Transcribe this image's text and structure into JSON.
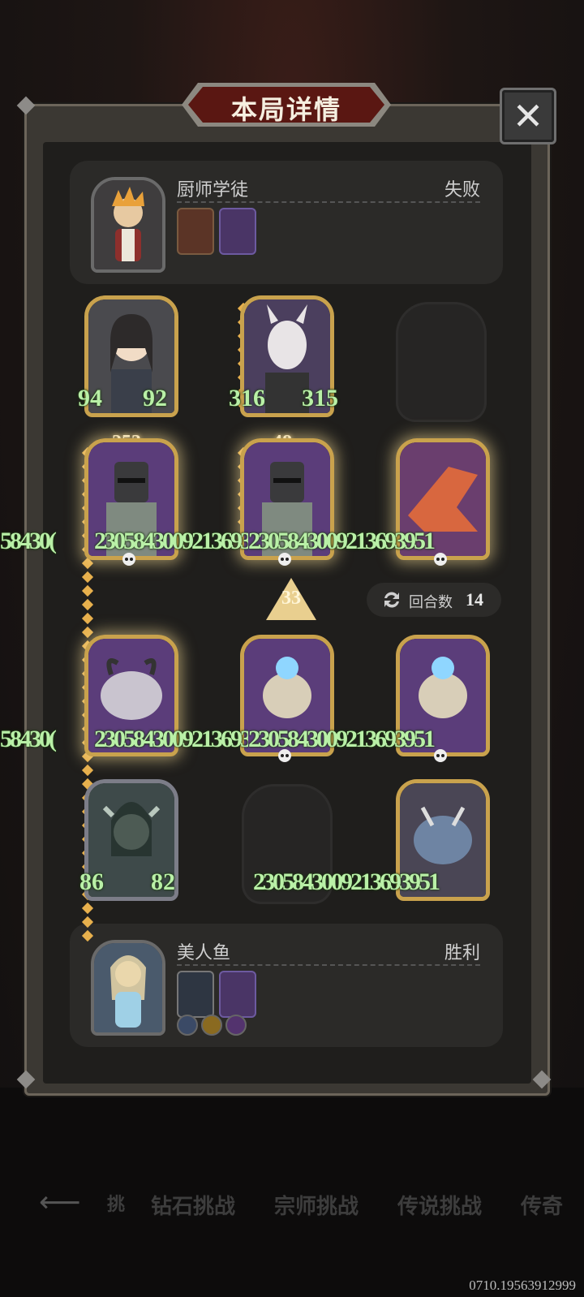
{
  "modal": {
    "title": "本局详情",
    "close_label": "✕"
  },
  "opponent": {
    "name": "厨师学徒",
    "result": "失败"
  },
  "player": {
    "name": "美人鱼",
    "result": "胜利"
  },
  "board": {
    "row1": [
      {
        "attack": "94",
        "health": "92"
      },
      {
        "attack": "316",
        "health": "315"
      }
    ],
    "top_counts": [
      "253",
      "48"
    ],
    "overlay_text": "2305843009213693951",
    "overlay_left": "58430(",
    "row4": [
      {
        "attack": "86",
        "health": "82"
      }
    ]
  },
  "turn_arrow": "33",
  "round_counter": {
    "label": "回合数",
    "value": "14"
  },
  "bottom_nav": {
    "tabs": [
      "钻石挑战",
      "宗师挑战",
      "传说挑战",
      "传奇"
    ],
    "partial": "挑"
  },
  "build_id": "0710.19563912999",
  "colors": {
    "stat_green": "#b9f0a7",
    "gold_frame": "#c9a24d",
    "title_red": "#5a1712"
  }
}
